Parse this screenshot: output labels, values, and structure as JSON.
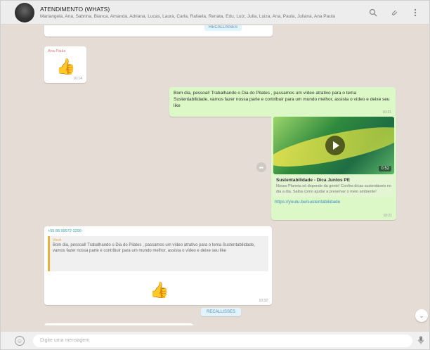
{
  "header": {
    "contact_name": "ATENDIMENTO (WHATS)",
    "participants": "Mariangela, Ana, Sabrina, Bianca, Amanda, Adriana, Lucas, Laura, Carla, Rafaela, Renata, Edu, Luiz, Julia, Luiza, Ana, Paula, Juliana, Ana Paula"
  },
  "messages": {
    "stub_button": "RECALLISSES",
    "emoji_author": "Ana Paula",
    "emoji_time": "10:14",
    "out_text": "Bom dia, pessoal! Trabalhando o Dia do Pilates , passamos um vídeo atrativo para o tema Sustentabilidade, vamos fazer nossa parte e contribuir para um mundo melhor, assista o vídeo e deixe seu like",
    "out_time": "10:21",
    "video_duration": "0:52",
    "video_title": "Sustentabilidade - Dica Juntos PE",
    "video_desc": "Nosso Planeta só depende da gente! Confira dicas sustentáveis no dia a dia. Saiba como ajudar a preservar o meio ambiente!",
    "video_link": "https://youtu.be/sustentabilidade",
    "video_time": "10:21",
    "quote_author": "+55 88 99572-3290",
    "quote_name": "Você",
    "quote_text": "Bom dia, pessoal! Trabalhando o Dia do Pilates , passamos um vídeo atrativo para o tema Sustentabilidade, vamos fazer nossa parte e contribuir para um mundo melhor, assista o vídeo e deixe seu like",
    "quote_time": "10:32",
    "bottom_button": "RECALLISSES"
  },
  "footer": {
    "placeholder": "Digite uma mensagem"
  },
  "icons": {
    "avatar": "group-avatar",
    "search": "search-icon",
    "attach": "paperclip-icon",
    "menu": "menu-icon",
    "emoji": "emoji-icon",
    "mic": "mic-icon",
    "play": "play-icon",
    "forward": "forward-icon",
    "thumbs_up": "thumbs-up"
  },
  "colors": {
    "outgoing_bubble": "#dcf8c6",
    "chat_background": "#e5ddd5",
    "link": "#3b89c9"
  }
}
